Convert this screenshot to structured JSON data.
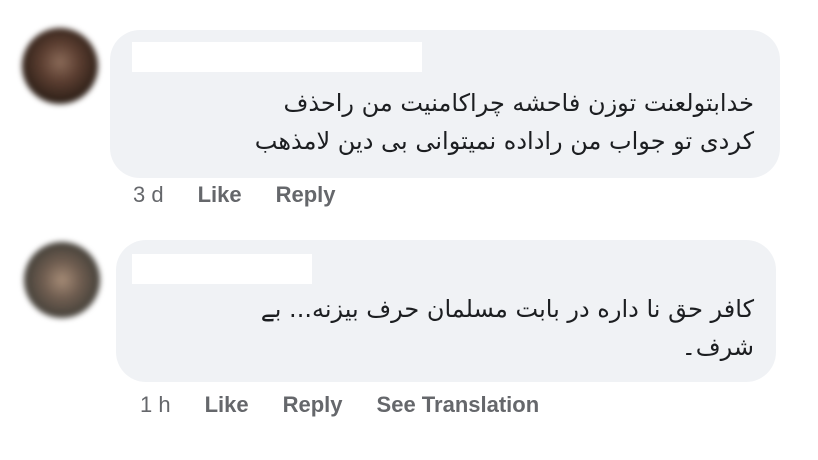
{
  "comments": [
    {
      "text_line1": "خدابتولعنت توزن فاحشه چراکامنیت من راحذف",
      "text_line2": "کردی تو جواب من راداده نمیتوانی بی دین لامذهب",
      "time": "3 d",
      "like": "Like",
      "reply": "Reply"
    },
    {
      "text_line1": "کافر حق نا داره در بابت مسلمان حرف بیزنه... بے",
      "text_line2": "شرف۔",
      "time": "1 h",
      "like": "Like",
      "reply": "Reply",
      "see_translation": "See Translation"
    }
  ]
}
